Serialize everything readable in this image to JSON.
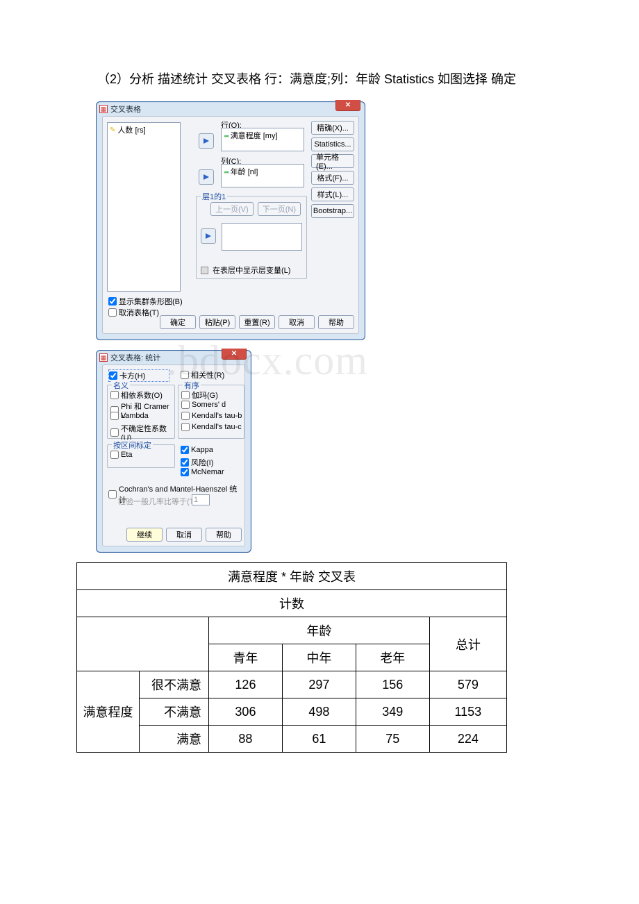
{
  "instruction": "（2）分析 描述统计 交叉表格 行：满意度;列：年龄 Statistics 如图选择 确定",
  "dialog1": {
    "title": "交叉表格",
    "source_var": "人数 [rs]",
    "row_label": "行(O):",
    "row_var": "满意程度 [my]",
    "col_label": "列(C):",
    "col_var": "年龄 [nl]",
    "layer_title": "层1的1",
    "btn_prev": "上一页(V)",
    "btn_next": "下一页(N)",
    "layer_checkbox": "在表层中显示层变量(L)",
    "chk_cluster": "显示集群条形图(B)",
    "chk_suppress": "取消表格(T)",
    "btns": {
      "ok": "确定",
      "paste": "粘贴(P)",
      "reset": "重置(R)",
      "cancel": "取消",
      "help": "帮助"
    },
    "side": {
      "exact": "精确(X)...",
      "stats": "Statistics...",
      "cells": "单元格(E)...",
      "format": "格式(F)...",
      "style": "样式(L)...",
      "boot": "Bootstrap..."
    }
  },
  "dialog2": {
    "title": "交叉表格: 统计",
    "chi": "卡方(H)",
    "corr": "相关性(R)",
    "nominal_title": "名义",
    "nominal": {
      "cc": "相依系数(O)",
      "phi": "Phi 和 Cramer V",
      "lambda": "Lambda",
      "uc": "不确定性系数(U)"
    },
    "ordinal_title": "有序",
    "ordinal": {
      "gamma": "伽玛(G)",
      "somers": "Somers' d",
      "taub": "Kendall's tau-b",
      "tauc": "Kendall's tau-c"
    },
    "interval_title": "按区间标定",
    "eta": "Eta",
    "kappa": "Kappa",
    "risk": "风险(I)",
    "mcnemar": "McNemar",
    "cochran": "Cochran's and Mantel-Haenszel 统计",
    "odds_label": "检验一般几率比等于(T):",
    "odds_val": "1",
    "btns": {
      "cont": "继续",
      "cancel": "取消",
      "help": "帮助"
    }
  },
  "table": {
    "title": "满意程度 * 年龄 交叉表",
    "count": "计数",
    "col_group": "年龄",
    "cols": [
      "青年",
      "中年",
      "老年"
    ],
    "total_col": "总计",
    "row_group": "满意程度",
    "rows": [
      {
        "label": "很不满意",
        "v": [
          126,
          297,
          156
        ],
        "t": 579
      },
      {
        "label": "不满意",
        "v": [
          306,
          498,
          349
        ],
        "t": 1153
      },
      {
        "label": "满意",
        "v": [
          88,
          61,
          75
        ],
        "t": 224
      }
    ]
  },
  "watermark": ".bdocx.com"
}
